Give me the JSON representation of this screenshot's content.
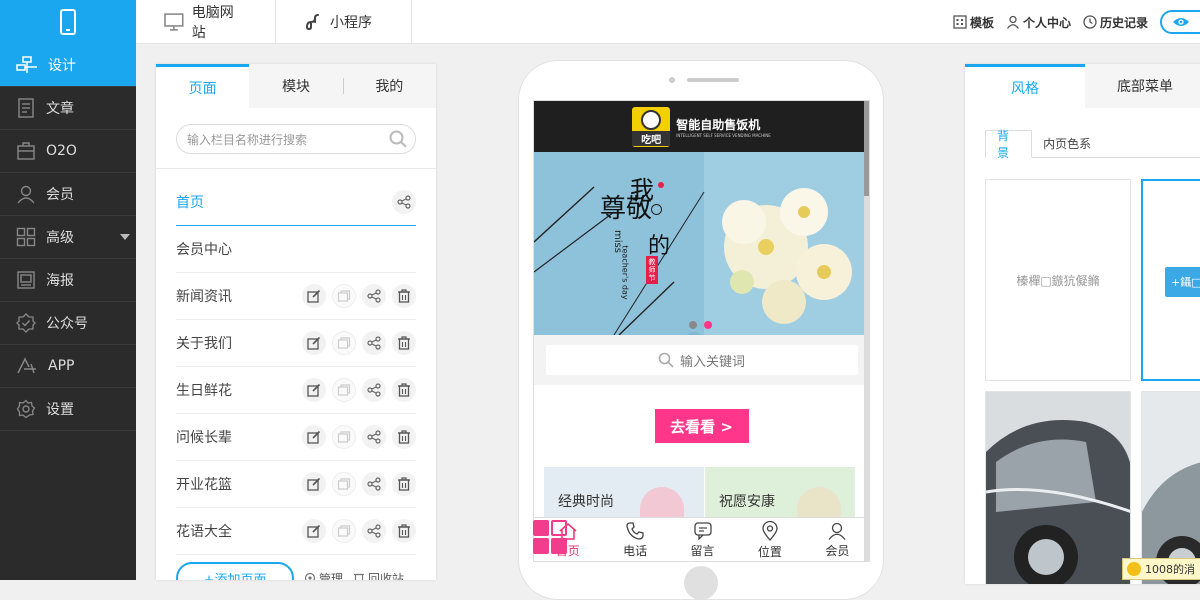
{
  "topbar": {
    "tabs": [
      {
        "label": "电脑网站",
        "icon": "monitor-icon"
      },
      {
        "label": "小程序",
        "icon": "mini-program-icon"
      }
    ],
    "right": [
      {
        "label": "模板",
        "icon": "template-icon"
      },
      {
        "label": "个人中心",
        "icon": "user-icon"
      },
      {
        "label": "历史记录",
        "icon": "clock-icon"
      }
    ],
    "preview_icon": "eye-icon",
    "accent": "#1aa7f0"
  },
  "sidebar": {
    "items": [
      {
        "label": "设计",
        "icon": "design-icon",
        "active": true
      },
      {
        "label": "文章",
        "icon": "article-icon"
      },
      {
        "label": "O2O",
        "icon": "o2o-icon"
      },
      {
        "label": "会员",
        "icon": "member-icon"
      },
      {
        "label": "高级",
        "icon": "advanced-icon"
      },
      {
        "label": "海报",
        "icon": "poster-icon"
      },
      {
        "label": "公众号",
        "icon": "wechat-account-icon"
      },
      {
        "label": "APP",
        "icon": "app-icon"
      },
      {
        "label": "设置",
        "icon": "settings-icon"
      }
    ]
  },
  "left_panel": {
    "tabs": [
      "页面",
      "模块",
      "我的"
    ],
    "search_placeholder": "输入栏目名称进行搜索",
    "pages": [
      "首页",
      "会员中心",
      "新闻资讯",
      "关于我们",
      "生日鲜花",
      "问候长辈",
      "开业花篮",
      "花语大全"
    ],
    "add_page": "+添加页面",
    "manage": "管理",
    "recycle": "回收站"
  },
  "phone": {
    "brand_logo": "吃吧",
    "brand_name": "智能自助售饭机",
    "brand_subtitle": "INTELLIGENT SELF SERVICE VENDING MACHINE",
    "banner_text": {
      "wo": "我",
      "zunjing": "尊敬",
      "de": "的",
      "miss": "miss",
      "teachers": "teacher's day",
      "badge": "教师节"
    },
    "search_placeholder": "输入关键词",
    "cta": "去看看 >",
    "categories": [
      "经典时尚",
      "祝愿安康"
    ],
    "bottom_nav": [
      {
        "label": "首页",
        "icon": "home-icon"
      },
      {
        "label": "电话",
        "icon": "phone-icon"
      },
      {
        "label": "留言",
        "icon": "message-icon"
      },
      {
        "label": "位置",
        "icon": "location-icon"
      },
      {
        "label": "会员",
        "icon": "member-icon"
      }
    ],
    "accent": "#ff3689"
  },
  "right_panel": {
    "tabs": [
      "风格",
      "底部菜单"
    ],
    "subtabs": [
      "背景",
      "内页色系"
    ],
    "card1_text": "榛樿□鏃犺儗鏅",
    "card2_button": "+鑷□",
    "notice": "1008的消"
  }
}
